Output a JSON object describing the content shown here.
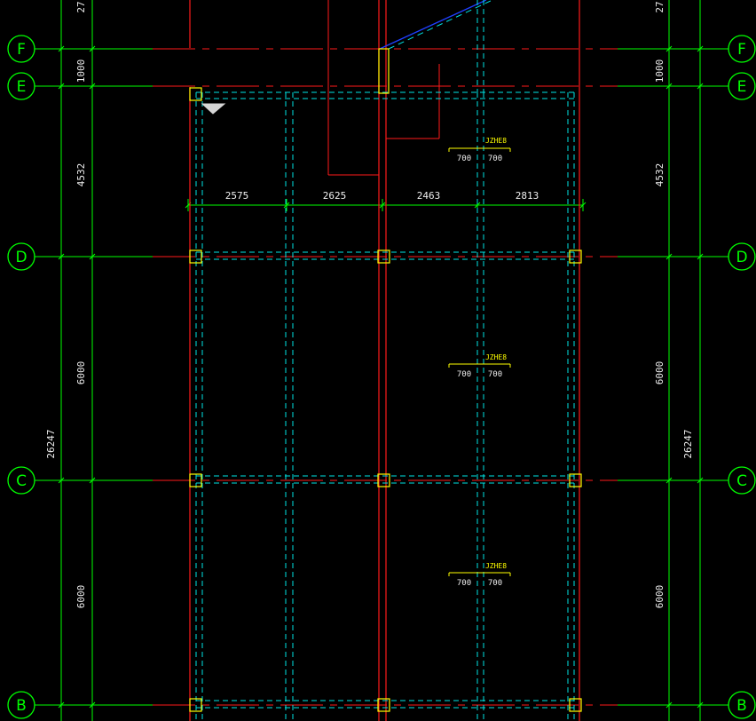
{
  "drawing": {
    "colors": {
      "background": "#000000",
      "axis_green": "#00ff00",
      "wall_red": "#ff1a1a",
      "beam_cyan": "#00e5e5",
      "column_yellow": "#ffff00",
      "blue_line": "#1f3fff",
      "text_white": "#f0f0f0",
      "text_yellow": "#ffff00"
    },
    "axes": {
      "left_labels": [
        "F",
        "E",
        "D",
        "C",
        "B"
      ],
      "right_labels": [
        "F",
        "E",
        "D",
        "C",
        "B"
      ]
    },
    "dimensions": {
      "vertical_left": [
        "1000",
        "4532",
        "6000",
        "6000"
      ],
      "vertical_right": [
        "1000",
        "4532",
        "6000",
        "6000"
      ],
      "top_cut_left": "27",
      "top_cut_right": "27",
      "total_left": "26247",
      "total_right": "26247",
      "horizontal": [
        "2575",
        "2625",
        "2463",
        "2813"
      ]
    },
    "annotations": [
      {
        "code": "JZHE8",
        "left": "700",
        "right": "700"
      },
      {
        "code": "JZHE8",
        "left": "700",
        "right": "700"
      },
      {
        "code": "JZHE8",
        "left": "700",
        "right": "700"
      }
    ]
  }
}
